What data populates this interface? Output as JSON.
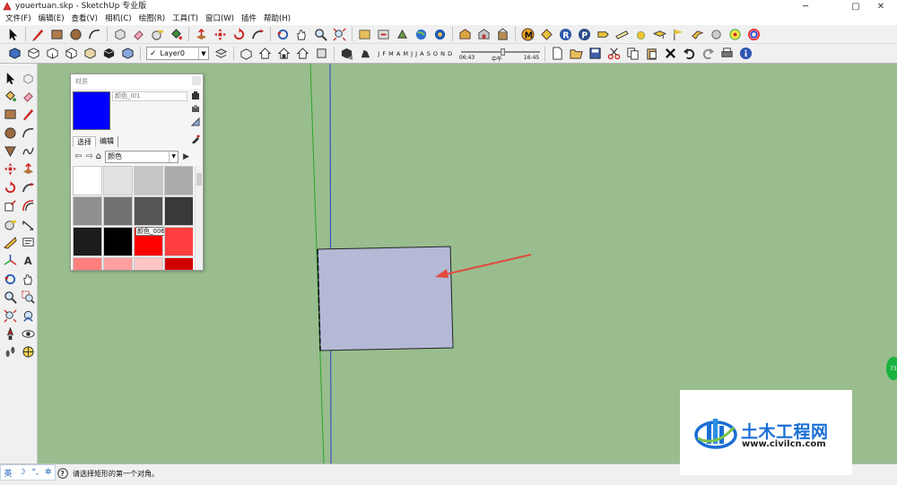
{
  "window": {
    "title": "youertuan.skp - SketchUp 专业版",
    "minimize": "─",
    "maximize": "▢",
    "close": "✕"
  },
  "menu": [
    "文件(F)",
    "编辑(E)",
    "查看(V)",
    "相机(C)",
    "绘图(R)",
    "工具(T)",
    "窗口(W)",
    "插件",
    "帮助(H)"
  ],
  "toolbar2": {
    "layer": "Layer0",
    "months": [
      "J",
      "F",
      "M",
      "A",
      "M",
      "J",
      "J",
      "A",
      "S",
      "O",
      "N",
      "D"
    ],
    "time_start": "06:43",
    "time_mid": "中午",
    "time_end": "16:45"
  },
  "materials": {
    "title": "材质",
    "name_field": "颜色_I01",
    "tabs": [
      "选择",
      "编辑"
    ],
    "library": "颜色",
    "current_color": "#0000ff",
    "swatches": [
      {
        "color": "#ffffff",
        "label": ""
      },
      {
        "color": "#e2e2e2",
        "label": ""
      },
      {
        "color": "#c6c6c6",
        "label": ""
      },
      {
        "color": "#aaaaaa",
        "label": ""
      },
      {
        "color": "#8f8f8f",
        "label": ""
      },
      {
        "color": "#727272",
        "label": ""
      },
      {
        "color": "#555555",
        "label": ""
      },
      {
        "color": "#393939",
        "label": ""
      },
      {
        "color": "#1c1c1c",
        "label": ""
      },
      {
        "color": "#000000",
        "label": ""
      },
      {
        "color": "#ff0000",
        "label": "颜色_006"
      },
      {
        "color": "#ff3f3f",
        "label": ""
      },
      {
        "color": "#ff7f7f",
        "label": ""
      },
      {
        "color": "#ffa0a0",
        "label": ""
      },
      {
        "color": "#ffc6c6",
        "label": ""
      },
      {
        "color": "#d00000",
        "label": ""
      }
    ]
  },
  "status": {
    "ime": [
      "英",
      "☽",
      "°,",
      "✲"
    ],
    "hint": "请选择矩形的第一个对角。"
  },
  "watermark": {
    "title": "土木工程网",
    "url": "www.civilcn.com"
  },
  "badge": "73",
  "colors": {
    "viewport": "#99bd8e",
    "face": "#b4b9d6",
    "green_axis": "#2aa52a",
    "blue_axis": "#2b3fc0",
    "arrow": "#e04a3c"
  }
}
